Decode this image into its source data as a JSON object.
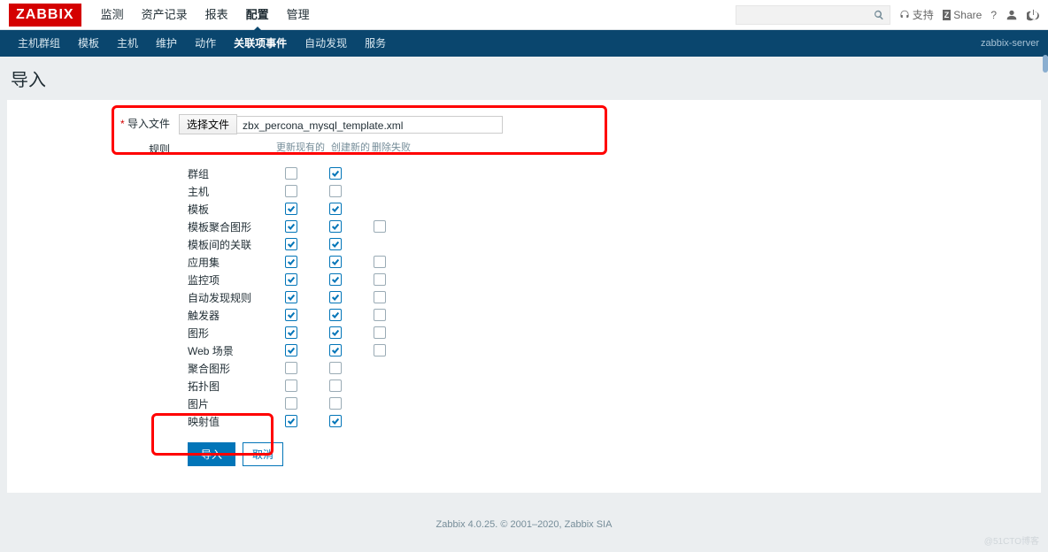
{
  "header": {
    "logo": "ZABBIX",
    "topnav": [
      "监测",
      "资产记录",
      "报表",
      "配置",
      "管理"
    ],
    "topnav_active": 3,
    "support": "支持",
    "share": "Share",
    "help": "?",
    "server_label": "zabbix-server"
  },
  "subnav": {
    "items": [
      "主机群组",
      "模板",
      "主机",
      "维护",
      "动作",
      "关联项事件",
      "自动发现",
      "服务"
    ],
    "active": 5
  },
  "page": {
    "title": "导入",
    "import_file_label": "导入文件",
    "choose_file_btn": "选择文件",
    "file_name": "zbx_percona_mysql_template.xml",
    "rules_label": "规则",
    "col_update": "更新现有的",
    "col_create": "创建新的",
    "col_delete": "删除失败",
    "rules": [
      {
        "name": "群组",
        "c1": false,
        "c2": true,
        "c3": null
      },
      {
        "name": "主机",
        "c1": false,
        "c2": false,
        "c3": null
      },
      {
        "name": "模板",
        "c1": true,
        "c2": true,
        "c3": null
      },
      {
        "name": "模板聚合图形",
        "c1": true,
        "c2": true,
        "c3": false
      },
      {
        "name": "模板间的关联",
        "c1": true,
        "c2": true,
        "c3": null
      },
      {
        "name": "应用集",
        "c1": true,
        "c2": true,
        "c3": false
      },
      {
        "name": "监控项",
        "c1": true,
        "c2": true,
        "c3": false
      },
      {
        "name": "自动发现规则",
        "c1": true,
        "c2": true,
        "c3": false
      },
      {
        "name": "触发器",
        "c1": true,
        "c2": true,
        "c3": false
      },
      {
        "name": "图形",
        "c1": true,
        "c2": true,
        "c3": false
      },
      {
        "name": "Web 场景",
        "c1": true,
        "c2": true,
        "c3": false
      },
      {
        "name": "聚合图形",
        "c1": false,
        "c2": false,
        "c3": null
      },
      {
        "name": "拓扑图",
        "c1": false,
        "c2": false,
        "c3": null
      },
      {
        "name": "图片",
        "c1": false,
        "c2": false,
        "c3": null
      },
      {
        "name": "映射值",
        "c1": true,
        "c2": true,
        "c3": null
      }
    ],
    "btn_import": "导入",
    "btn_cancel": "取消"
  },
  "footer": "Zabbix 4.0.25. © 2001–2020, Zabbix SIA",
  "watermark": "@51CTO博客"
}
